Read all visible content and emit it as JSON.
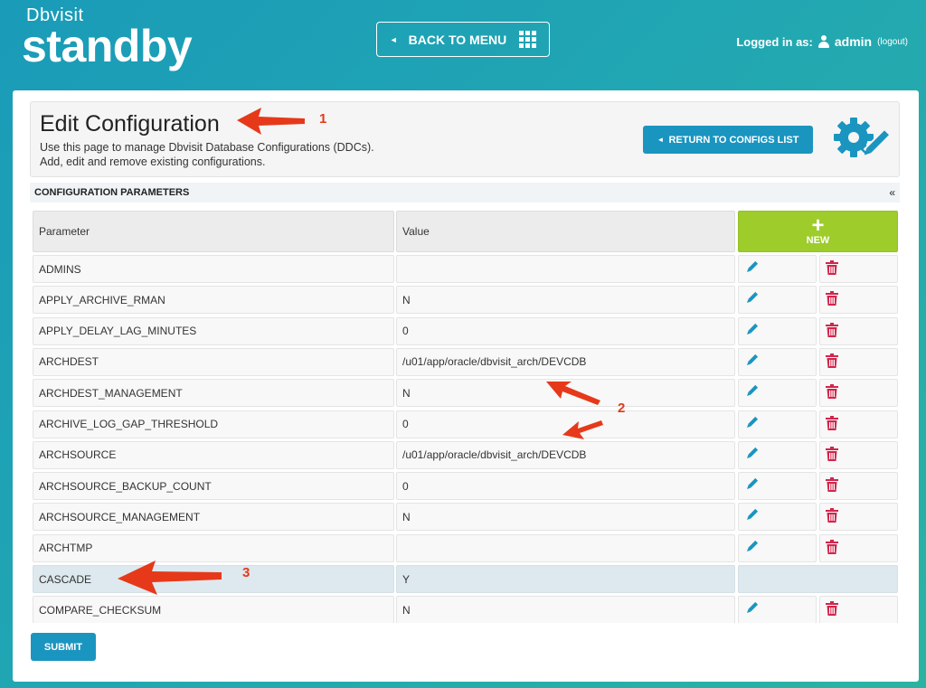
{
  "header": {
    "logo_top": "Dbvisit",
    "logo_bottom": "standby",
    "back_to_menu": "BACK TO MENU",
    "logged_in_label": "Logged in as:",
    "username": "admin",
    "logout": "(logout)"
  },
  "page": {
    "title": "Edit Configuration",
    "description_line1": "Use this page to manage Dbvisit Database Configurations (DDCs).",
    "description_line2": "Add, edit and remove existing configurations.",
    "return_button": "RETURN TO CONFIGS LIST",
    "section_title": "CONFIGURATION PARAMETERS",
    "collapse_glyph": "«",
    "submit": "SUBMIT"
  },
  "table": {
    "col_parameter": "Parameter",
    "col_value": "Value",
    "new_plus": "+",
    "new_label": "NEW",
    "rows": [
      {
        "param": "ADMINS",
        "value": ""
      },
      {
        "param": "APPLY_ARCHIVE_RMAN",
        "value": "N"
      },
      {
        "param": "APPLY_DELAY_LAG_MINUTES",
        "value": "0"
      },
      {
        "param": "ARCHDEST",
        "value": "/u01/app/oracle/dbvisit_arch/DEVCDB"
      },
      {
        "param": "ARCHDEST_MANAGEMENT",
        "value": "N"
      },
      {
        "param": "ARCHIVE_LOG_GAP_THRESHOLD",
        "value": "0"
      },
      {
        "param": "ARCHSOURCE",
        "value": "/u01/app/oracle/dbvisit_arch/DEVCDB"
      },
      {
        "param": "ARCHSOURCE_BACKUP_COUNT",
        "value": "0"
      },
      {
        "param": "ARCHSOURCE_MANAGEMENT",
        "value": "N"
      },
      {
        "param": "ARCHTMP",
        "value": ""
      },
      {
        "param": "CASCADE",
        "value": "Y"
      },
      {
        "param": "COMPARE_CHECKSUM",
        "value": "N"
      }
    ]
  },
  "annotations": {
    "n1": "1",
    "n2": "2",
    "n3": "3"
  },
  "colors": {
    "accent_blue": "#1a95c0",
    "new_green": "#9dcc2b",
    "delete_red": "#d0264c",
    "annotation_red": "#e13a1a"
  }
}
